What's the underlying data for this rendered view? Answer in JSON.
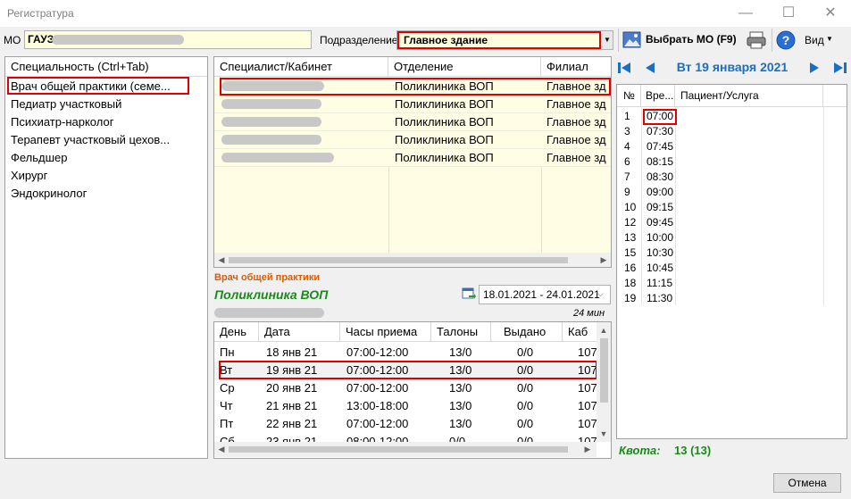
{
  "window": {
    "title": "Регистратура",
    "minimize": "—",
    "maximize": "☐",
    "close": "✕"
  },
  "toolbar": {
    "mo_label": "МО",
    "mo_value": "ГАУЗ",
    "subdivision_label": "Подразделение",
    "subdivision_value": "Главное здание",
    "choose_mo_label": "Выбрать МО (F9)",
    "view_label": "Вид"
  },
  "specialties": {
    "header": "Специальность (Ctrl+Tab)",
    "items": [
      "Врач общей практики (семе...",
      "Педиатр участковый",
      "Психиатр-нарколог",
      "Терапевт участковый цехов...",
      "Фельдшер",
      "Хирург",
      "Эндокринолог"
    ]
  },
  "specialists": {
    "columns": [
      "Специалист/Кабинет",
      "Отделение",
      "Филиал"
    ],
    "rows": [
      {
        "department": "Поликлиника ВОП",
        "branch": "Главное зд"
      },
      {
        "department": "Поликлиника ВОП",
        "branch": "Главное зд"
      },
      {
        "department": "Поликлиника ВОП",
        "branch": "Главное зд"
      },
      {
        "department": "Поликлиника ВОП",
        "branch": "Главное зд"
      },
      {
        "department": "Поликлиника ВОП",
        "branch": "Главное зд"
      }
    ]
  },
  "detail": {
    "specialty": "Врач общей практики",
    "department": "Поликлиника ВОП",
    "date_range": "18.01.2021 - 24.01.2021",
    "duration": "24 мин"
  },
  "schedule": {
    "columns": [
      "День",
      "Дата",
      "Часы приема",
      "Талоны",
      "Выдано",
      "Каб"
    ],
    "rows": [
      {
        "day": "Пн",
        "date": "18 янв 21",
        "hours": "07:00-12:00",
        "tickets": "13/0",
        "issued": "0/0",
        "room": "107"
      },
      {
        "day": "Вт",
        "date": "19 янв 21",
        "hours": "07:00-12:00",
        "tickets": "13/0",
        "issued": "0/0",
        "room": "107"
      },
      {
        "day": "Ср",
        "date": "20 янв 21",
        "hours": "07:00-12:00",
        "tickets": "13/0",
        "issued": "0/0",
        "room": "107"
      },
      {
        "day": "Чт",
        "date": "21 янв 21",
        "hours": "13:00-18:00",
        "tickets": "13/0",
        "issued": "0/0",
        "room": "107"
      },
      {
        "day": "Пт",
        "date": "22 янв 21",
        "hours": "07:00-12:00",
        "tickets": "13/0",
        "issued": "0/0",
        "room": "107"
      },
      {
        "day": "Сб",
        "date": "23 янв 21",
        "hours": "08:00-12:00",
        "tickets": "0/0",
        "issued": "0/0",
        "room": "107"
      }
    ]
  },
  "calendar": {
    "date_title": "Вт 19 января 2021",
    "columns": [
      "№",
      "Вре...",
      "Пациент/Услуга"
    ],
    "rows": [
      {
        "num": "1",
        "time": "07:00"
      },
      {
        "num": "3",
        "time": "07:30"
      },
      {
        "num": "4",
        "time": "07:45"
      },
      {
        "num": "6",
        "time": "08:15"
      },
      {
        "num": "7",
        "time": "08:30"
      },
      {
        "num": "9",
        "time": "09:00"
      },
      {
        "num": "10",
        "time": "09:15"
      },
      {
        "num": "12",
        "time": "09:45"
      },
      {
        "num": "13",
        "time": "10:00"
      },
      {
        "num": "15",
        "time": "10:30"
      },
      {
        "num": "16",
        "time": "10:45"
      },
      {
        "num": "18",
        "time": "11:15"
      },
      {
        "num": "19",
        "time": "11:30"
      }
    ]
  },
  "quota": {
    "label": "Квота:",
    "value": "13 (13)"
  },
  "footer": {
    "cancel_label": "Отмена"
  },
  "colors": {
    "accent_blue": "#1a6fc4",
    "red_highlight": "#e00000",
    "green_text": "#1a8a1a",
    "orange_text": "#e05a00",
    "yellow_row": "#fffde4"
  }
}
